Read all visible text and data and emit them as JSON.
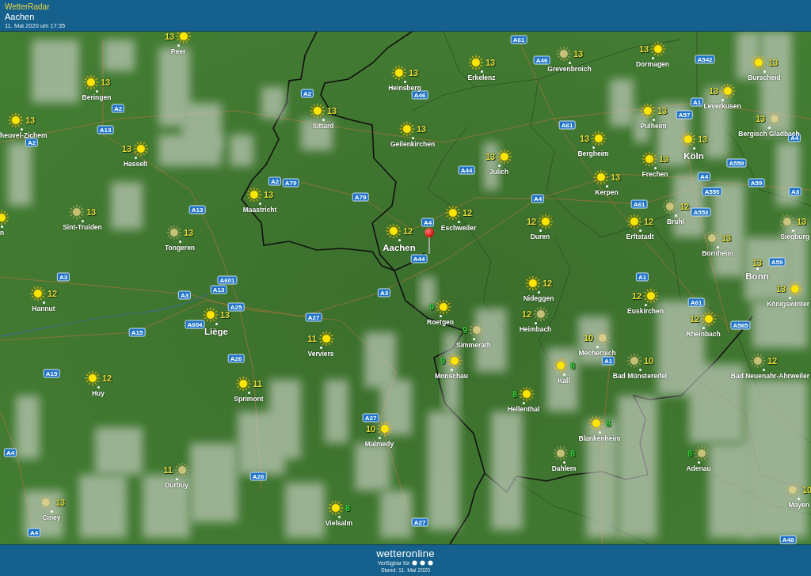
{
  "header": {
    "app_title": "WetterRadar",
    "location": "Aachen",
    "timestamp": "11. Mai 2020 um 17:35"
  },
  "cities": [
    {
      "name": "Peer",
      "temp": "13",
      "color": "#e3de3c",
      "icon": {
        "kind": "sun",
        "dimmed": false
      },
      "kind": "town"
    },
    {
      "name": "Beringen",
      "temp": "13",
      "color": "#e3de3c",
      "icon": {
        "kind": "sun",
        "dimmed": false
      },
      "kind": "town"
    },
    {
      "name": "heuvel-Zichem",
      "temp": "13",
      "color": "#e3de3c",
      "icon": {
        "kind": "sun",
        "dimmed": false
      },
      "kind": "town"
    },
    {
      "name": "Hasselt",
      "temp": "13",
      "color": "#e3de3c",
      "icon": {
        "kind": "sun",
        "dimmed": false
      },
      "kind": "town"
    },
    {
      "name": "n",
      "icon": {
        "kind": "sun",
        "dimmed": false
      },
      "kind": "town"
    },
    {
      "name": "Sint-Truiden",
      "temp": "13",
      "color": "#e3de3c",
      "icon": {
        "kind": "sun",
        "dimmed": true
      },
      "kind": "town"
    },
    {
      "name": "Tongeren",
      "temp": "13",
      "color": "#e3de3c",
      "icon": {
        "kind": "sun",
        "dimmed": true
      },
      "kind": "town"
    },
    {
      "name": "Maastricht",
      "temp": "13",
      "color": "#e3de3c",
      "icon": {
        "kind": "sun",
        "dimmed": false
      },
      "kind": "town"
    },
    {
      "name": "Sittard",
      "temp": "13",
      "color": "#e3de3c",
      "icon": {
        "kind": "sun",
        "dimmed": false
      },
      "kind": "town"
    },
    {
      "name": "Heinsberg",
      "temp": "13",
      "color": "#e3de3c",
      "icon": {
        "kind": "sun",
        "dimmed": false
      },
      "kind": "town"
    },
    {
      "name": "Geilenkirchen",
      "temp": "13",
      "color": "#e3de3c",
      "icon": {
        "kind": "sun",
        "dimmed": false
      },
      "kind": "town"
    },
    {
      "name": "Aachen",
      "temp": "12",
      "color": "#e3de3c",
      "icon": {
        "kind": "sun",
        "dimmed": false
      },
      "kind": "major"
    },
    {
      "name": "Erkelenz",
      "temp": "13",
      "color": "#e3de3c",
      "icon": {
        "kind": "sun",
        "dimmed": false
      },
      "kind": "town"
    },
    {
      "name": "Grevenbroich",
      "temp": "13",
      "color": "#e3de3c",
      "icon": {
        "kind": "sun",
        "dimmed": true
      },
      "kind": "town"
    },
    {
      "name": "Dormagen",
      "temp": "13",
      "color": "#e3de3c",
      "icon": {
        "kind": "sun",
        "dimmed": false
      },
      "kind": "town"
    },
    {
      "name": "Burscheid",
      "temp": "13",
      "color": "#e3de3c",
      "icon": {
        "kind": "sun",
        "dimmed": false
      },
      "kind": "town"
    },
    {
      "name": "Leverkusen",
      "temp": "13",
      "color": "#e3de3c",
      "icon": {
        "kind": "sun",
        "dimmed": false
      },
      "kind": "town"
    },
    {
      "name": "Pulheim",
      "temp": "13",
      "color": "#e3de3c",
      "icon": {
        "kind": "sun",
        "dimmed": false
      },
      "kind": "town"
    },
    {
      "name": "Bergisch Gladbach",
      "temp": "13",
      "color": "#e3de3c",
      "icon": {
        "kind": "sun",
        "dimmed": true
      },
      "kind": "town"
    },
    {
      "name": "Bergheim",
      "temp": "13",
      "color": "#e3de3c",
      "icon": {
        "kind": "sun",
        "dimmed": false
      },
      "kind": "town"
    },
    {
      "name": "Köln",
      "temp": "13",
      "color": "#e3de3c",
      "icon": {
        "kind": "sun",
        "dimmed": false
      },
      "kind": "major"
    },
    {
      "name": "Julich",
      "temp": "13",
      "color": "#e3de3c",
      "icon": {
        "kind": "sun",
        "dimmed": false
      },
      "kind": "town"
    },
    {
      "name": "Frechen",
      "temp": "13",
      "color": "#e3de3c",
      "icon": {
        "kind": "sun",
        "dimmed": false
      },
      "kind": "town"
    },
    {
      "name": "Kerpen",
      "temp": "13",
      "color": "#e3de3c",
      "icon": {
        "kind": "sun",
        "dimmed": false
      },
      "kind": "town"
    },
    {
      "name": "Eschweiler",
      "temp": "12",
      "color": "#e3de3c",
      "icon": {
        "kind": "sun",
        "dimmed": false
      },
      "kind": "town"
    },
    {
      "name": "Duren",
      "temp": "12",
      "color": "#e3de3c",
      "icon": {
        "kind": "sun",
        "dimmed": false
      },
      "kind": "town"
    },
    {
      "name": "Erftstadt",
      "temp": "12",
      "color": "#e3de3c",
      "icon": {
        "kind": "sun",
        "dimmed": false
      },
      "kind": "town"
    },
    {
      "name": "Bruhl",
      "temp": "12",
      "color": "#e3de3c",
      "icon": {
        "kind": "sun",
        "dimmed": true
      },
      "kind": "town"
    },
    {
      "name": "Bornheim",
      "temp": "13",
      "color": "#e3de3c",
      "icon": {
        "kind": "sun",
        "dimmed": true
      },
      "kind": "town"
    },
    {
      "name": "Siegburg",
      "temp": "13",
      "color": "#e3de3c",
      "icon": {
        "kind": "sun",
        "dimmed": true
      },
      "kind": "town"
    },
    {
      "name": "Bonn",
      "temp": "13",
      "color": "#e3de3c",
      "kind": "major"
    },
    {
      "name": "Hannut",
      "temp": "12",
      "color": "#e3de3c",
      "icon": {
        "kind": "sun",
        "dimmed": false
      },
      "kind": "town"
    },
    {
      "name": "Königswinter",
      "temp": "13",
      "color": "#e3de3c",
      "icon": {
        "kind": "sun",
        "dimmed": false
      },
      "kind": "town"
    },
    {
      "name": "Liège",
      "temp": "13",
      "color": "#e3de3c",
      "icon": {
        "kind": "sun",
        "dimmed": false
      },
      "kind": "major"
    },
    {
      "name": "Nideggen",
      "temp": "12",
      "color": "#e3de3c",
      "icon": {
        "kind": "sun",
        "dimmed": false
      },
      "kind": "town"
    },
    {
      "name": "Euskirchen",
      "temp": "12",
      "color": "#e3de3c",
      "icon": {
        "kind": "sun",
        "dimmed": false
      },
      "kind": "town"
    },
    {
      "name": "Roetgen",
      "temp": "9",
      "color": "#35d43c",
      "icon": {
        "kind": "sun",
        "dimmed": false
      },
      "kind": "town"
    },
    {
      "name": "Heimbach",
      "temp": "12",
      "color": "#e3de3c",
      "icon": {
        "kind": "sun",
        "dimmed": true
      },
      "kind": "town"
    },
    {
      "name": "Rheinbach",
      "temp": "12",
      "color": "#e3de3c",
      "icon": {
        "kind": "sun",
        "dimmed": false
      },
      "kind": "town"
    },
    {
      "name": "Verviers",
      "temp": "11",
      "color": "#e3de3c",
      "icon": {
        "kind": "sun",
        "dimmed": false
      },
      "kind": "town"
    },
    {
      "name": "Simmerath",
      "temp": "9",
      "color": "#35d43c",
      "icon": {
        "kind": "sun",
        "dimmed": true
      },
      "kind": "town"
    },
    {
      "name": "Mechernich",
      "temp": "10",
      "color": "#e3de3c",
      "icon": {
        "kind": "sun",
        "dimmed": true
      },
      "kind": "town"
    },
    {
      "name": "Monschau",
      "temp": "9",
      "color": "#35d43c",
      "icon": {
        "kind": "sun",
        "dimmed": false
      },
      "kind": "town"
    },
    {
      "name": "Kall",
      "temp": "8",
      "color": "#35d43c",
      "icon": {
        "kind": "sun",
        "dimmed": false
      },
      "kind": "town"
    },
    {
      "name": "Bad Münstereifel",
      "temp": "10",
      "color": "#e3de3c",
      "icon": {
        "kind": "sun",
        "dimmed": true
      },
      "kind": "town"
    },
    {
      "name": "Bad Neuenahr-Ahrweiler",
      "temp": "12",
      "color": "#e3de3c",
      "icon": {
        "kind": "sun",
        "dimmed": true
      },
      "kind": "town"
    },
    {
      "name": "Huy",
      "temp": "12",
      "color": "#e3de3c",
      "icon": {
        "kind": "sun",
        "dimmed": false
      },
      "kind": "town"
    },
    {
      "name": "Sprimont",
      "temp": "11",
      "color": "#e3de3c",
      "icon": {
        "kind": "sun",
        "dimmed": false
      },
      "kind": "town"
    },
    {
      "name": "Hellenthal",
      "temp": "8",
      "color": "#35d43c",
      "icon": {
        "kind": "sun",
        "dimmed": false
      },
      "kind": "town"
    },
    {
      "name": "Blankenheim",
      "temp": "8",
      "color": "#35d43c",
      "icon": {
        "kind": "sun",
        "dimmed": false
      },
      "kind": "town"
    },
    {
      "name": "Malmedy",
      "temp": "10",
      "color": "#e3de3c",
      "icon": {
        "kind": "sun",
        "dimmed": false
      },
      "kind": "town"
    },
    {
      "name": "Dahlem",
      "temp": "8",
      "color": "#35d43c",
      "icon": {
        "kind": "sun",
        "dimmed": true
      },
      "kind": "town"
    },
    {
      "name": "Adenau",
      "temp": "8",
      "color": "#35d43c",
      "icon": {
        "kind": "sun",
        "dimmed": true
      },
      "kind": "town"
    },
    {
      "name": "Durbuy",
      "temp": "11",
      "color": "#e3de3c",
      "icon": {
        "kind": "sun",
        "dimmed": true
      },
      "kind": "town"
    },
    {
      "name": "Ciney",
      "temp": "13",
      "color": "#e3de3c",
      "icon": {
        "kind": "sun",
        "dimmed": true
      },
      "kind": "town"
    },
    {
      "name": "Vielsalm",
      "temp": "8",
      "color": "#35d43c",
      "icon": {
        "kind": "sun",
        "dimmed": false
      },
      "kind": "town"
    },
    {
      "name": "Mayen",
      "temp": "10",
      "color": "#e3de3c",
      "icon": {
        "kind": "sun",
        "dimmed": true
      },
      "kind": "town"
    }
  ],
  "road_signs": [
    "A61",
    "A46",
    "A542",
    "A2",
    "A46",
    "A2",
    "A1",
    "A57",
    "A13",
    "A61",
    "A4",
    "A2",
    "A44",
    "A559",
    "A2",
    "A79",
    "A4",
    "A59",
    "A555",
    "A3",
    "A79",
    "A4",
    "A61",
    "A13",
    "A553",
    "A4",
    "A44",
    "A59",
    "A3",
    "A1",
    "A601",
    "A13",
    "A3",
    "A25",
    "A3",
    "A27",
    "A61",
    "A604",
    "A565",
    "A15",
    "A26",
    "A1",
    "A15",
    "A27",
    "A4",
    "A26",
    "A27",
    "A4",
    "A48"
  ],
  "location_pin": {
    "selected": true
  },
  "footer": {
    "brand": "wetteronline",
    "availability": "Verfügbar für",
    "updated": "Stand: 11. Mai 2020"
  }
}
